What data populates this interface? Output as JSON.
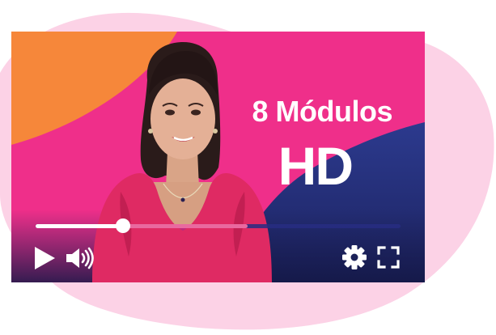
{
  "video": {
    "title_line1": "8 Módulos",
    "title_line2": "HD"
  },
  "player": {
    "progress": 0.24,
    "buffered": 0.58
  },
  "controls": {
    "play_icon": "play-icon",
    "volume_icon": "volume-icon",
    "settings_icon": "gear-icon",
    "fullscreen_icon": "fullscreen-icon"
  },
  "colors": {
    "video_pink": "#ef2f8a",
    "video_orange": "#f6873a",
    "video_navy": "#27307e",
    "backdrop_blob": "#fcd2e6",
    "progress_played": "#ffffff",
    "progress_buffered": "#e9699f",
    "progress_track": "#282d82"
  }
}
